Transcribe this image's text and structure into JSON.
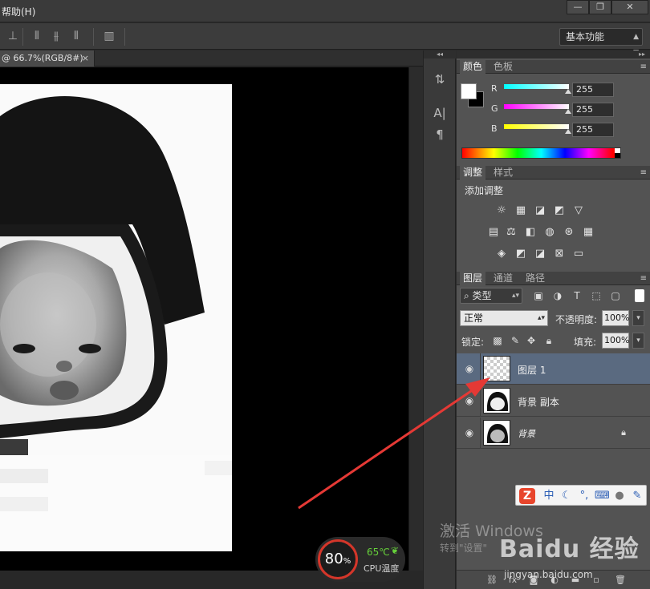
{
  "menu": {
    "help": "帮助(H)"
  },
  "window_controls": [
    "—",
    "❐",
    "✕"
  ],
  "options_bar": {
    "workspace": "基本功能"
  },
  "document": {
    "tab_title": "@ 66.7%(RGB/8#)",
    "close_glyph": "×"
  },
  "color_panel": {
    "tabs": [
      "颜色",
      "色板"
    ],
    "channels": [
      {
        "label": "R",
        "value": "255",
        "gradient": "#00ffff"
      },
      {
        "label": "G",
        "value": "255",
        "gradient": "#ff00ff"
      },
      {
        "label": "B",
        "value": "255",
        "gradient": "#ffff00"
      }
    ]
  },
  "adjustments_panel": {
    "tabs": [
      "调整",
      "样式"
    ],
    "title": "添加调整"
  },
  "layers_panel": {
    "tabs": [
      "图层",
      "通道",
      "路径"
    ],
    "filter": "类型",
    "blend_mode": "正常",
    "opacity_label": "不透明度:",
    "opacity": "100%",
    "lock_label": "锁定:",
    "fill_label": "填充:",
    "fill": "100%",
    "layers": [
      {
        "name": "图层 1",
        "selected": true
      },
      {
        "name": "背景 副本",
        "selected": false
      },
      {
        "name": "背景",
        "selected": false,
        "locked": true
      }
    ]
  },
  "ime": {
    "logo": "Z",
    "lang": "中"
  },
  "watermark": {
    "activate": "激活 Windows",
    "activate_sub": "转到\"设置\"",
    "baidu": "Baidu 经验",
    "baidu_url": "jingyan.baidu.com"
  },
  "cpu_widget": {
    "percent": "80",
    "unit": "%",
    "temperature": "65℃",
    "label": "CPU温度"
  },
  "colors": {
    "accent_red": "#e53935",
    "selected_layer": "#5a6a80",
    "panel_bg": "#535353"
  }
}
